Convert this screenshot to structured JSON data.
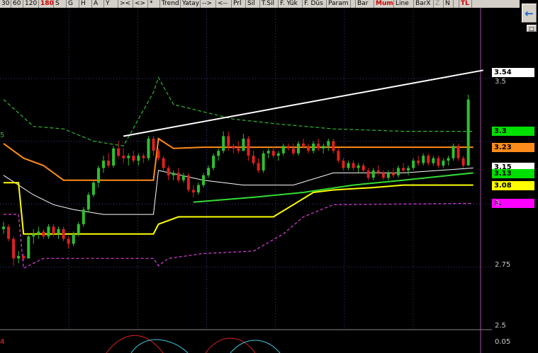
{
  "toolbar": [
    {
      "label": "30",
      "w": 16
    },
    {
      "label": "60",
      "w": 17
    },
    {
      "label": "120",
      "w": 22
    },
    {
      "label": "180",
      "w": 21,
      "style": "red"
    },
    {
      "label": "S",
      "w": 18
    },
    {
      "label": "G",
      "w": 18
    },
    {
      "label": "H",
      "w": 18
    },
    {
      "label": "A",
      "w": 17
    },
    {
      "label": "Y",
      "w": 20
    },
    {
      "label": "><",
      "w": 21
    },
    {
      "label": "<>",
      "w": 21
    },
    {
      "label": "*",
      "w": 17
    },
    {
      "label": "Trend",
      "w": 29
    },
    {
      "label": "Yatay",
      "w": 28
    },
    {
      "label": "-->",
      "w": 22
    },
    {
      "label": "<--",
      "w": 22
    },
    {
      "label": "Prl",
      "w": 20
    },
    {
      "label": "Sil",
      "w": 20
    },
    {
      "label": "T.Sil",
      "w": 26
    },
    {
      "label": "F. Yük",
      "w": 34
    },
    {
      "label": "F. Düs",
      "w": 34
    },
    {
      "label": "Param",
      "w": 34
    },
    {
      "label": "",
      "w": 7
    },
    {
      "label": "Bar",
      "w": 26
    },
    {
      "label": "Mum",
      "w": 28,
      "style": "red"
    },
    {
      "label": "Line",
      "w": 28
    },
    {
      "label": "BarX",
      "w": 28
    },
    {
      "label": "Z",
      "w": 14,
      "style": "disabled"
    },
    {
      "label": "N",
      "w": 14
    },
    {
      "label": "",
      "w": 8
    },
    {
      "label": "TL",
      "w": 18,
      "style": "red"
    }
  ],
  "nav": {
    "back_icon": "←",
    "close_icon": "□"
  },
  "price_tags": [
    {
      "label": "3.54",
      "bg": "#ffffff",
      "fg": "#000000",
      "price": 3.54
    },
    {
      "label": "3.3",
      "bg": "#00e000",
      "fg": "#000000",
      "price": 3.3
    },
    {
      "label": "3.23",
      "bg": "#ff8c1a",
      "fg": "#000000",
      "price": 3.235
    },
    {
      "label": "3.15",
      "bg": "#ffffff",
      "fg": "#000000",
      "price": 3.153
    },
    {
      "label": "3.13",
      "bg": "#00e000",
      "fg": "#000000",
      "price": 3.128
    },
    {
      "label": "3.08",
      "bg": "#ffff00",
      "fg": "#000000",
      "price": 3.077
    },
    {
      "label": "3.",
      "bg": "#ff00ff",
      "fg": "#000000",
      "price": 3.005
    }
  ],
  "axis_ticks": [
    {
      "label": "3.5",
      "price": 3.5
    },
    {
      "label": "3",
      "price": 3.0
    },
    {
      "label": "2.75",
      "price": 2.75
    },
    {
      "label": "2.5",
      "price": 2.5
    }
  ],
  "osc_tick": "0.05",
  "left_labels": [
    {
      "label": "5",
      "color": "#3cb43c"
    },
    {
      "label": "4",
      "color": "#ff3030"
    }
  ],
  "chart_data": {
    "type": "candlestick",
    "y_axis": {
      "min": 2.5,
      "max": 3.6
    },
    "colors": {
      "up": "#30c030",
      "down": "#e02020",
      "upper_band": "#2db82d",
      "orange": "#ff8c1a",
      "white_line": "#ffffff",
      "yellow": "#ffff00",
      "green_ma": "#33dd33",
      "magenta": "#e040e0",
      "trend": "#ffffff"
    },
    "candles": [
      [
        2.9,
        2.93,
        2.88,
        2.91
      ],
      [
        2.91,
        2.92,
        2.85,
        2.86
      ],
      [
        2.86,
        2.87,
        2.75,
        2.78
      ],
      [
        2.78,
        2.81,
        2.76,
        2.79
      ],
      [
        2.79,
        2.8,
        2.77,
        2.78
      ],
      [
        2.78,
        2.88,
        2.78,
        2.87
      ],
      [
        2.87,
        2.9,
        2.84,
        2.88
      ],
      [
        2.88,
        2.91,
        2.86,
        2.89
      ],
      [
        2.89,
        2.9,
        2.86,
        2.87
      ],
      [
        2.87,
        2.92,
        2.86,
        2.91
      ],
      [
        2.91,
        2.92,
        2.87,
        2.88
      ],
      [
        2.88,
        2.91,
        2.86,
        2.9
      ],
      [
        2.9,
        2.91,
        2.85,
        2.86
      ],
      [
        2.86,
        2.87,
        2.82,
        2.84
      ],
      [
        2.84,
        2.89,
        2.83,
        2.88
      ],
      [
        2.88,
        2.93,
        2.87,
        2.92
      ],
      [
        2.92,
        2.99,
        2.91,
        2.98
      ],
      [
        2.98,
        3.05,
        2.97,
        3.04
      ],
      [
        3.04,
        3.1,
        3.03,
        3.09
      ],
      [
        3.09,
        3.16,
        3.07,
        3.15
      ],
      [
        3.15,
        3.2,
        3.13,
        3.18
      ],
      [
        3.18,
        3.21,
        3.15,
        3.16
      ],
      [
        3.16,
        3.24,
        3.15,
        3.23
      ],
      [
        3.23,
        3.26,
        3.19,
        3.2
      ],
      [
        3.2,
        3.23,
        3.17,
        3.19
      ],
      [
        3.19,
        3.21,
        3.16,
        3.2
      ],
      [
        3.2,
        3.22,
        3.17,
        3.18
      ],
      [
        3.18,
        3.21,
        3.16,
        3.2
      ],
      [
        3.2,
        3.21,
        3.17,
        3.19
      ],
      [
        3.19,
        3.28,
        3.18,
        3.27
      ],
      [
        3.27,
        3.28,
        3.2,
        3.22
      ],
      [
        3.22,
        3.23,
        3.18,
        3.19
      ],
      [
        3.19,
        3.2,
        3.14,
        3.15
      ],
      [
        3.15,
        3.16,
        3.1,
        3.12
      ],
      [
        3.12,
        3.14,
        3.1,
        3.13
      ],
      [
        3.13,
        3.15,
        3.09,
        3.1
      ],
      [
        3.1,
        3.13,
        3.09,
        3.12
      ],
      [
        3.12,
        3.13,
        3.05,
        3.06
      ],
      [
        3.06,
        3.08,
        3.03,
        3.05
      ],
      [
        3.05,
        3.09,
        3.04,
        3.08
      ],
      [
        3.08,
        3.13,
        3.07,
        3.12
      ],
      [
        3.12,
        3.16,
        3.11,
        3.15
      ],
      [
        3.15,
        3.21,
        3.14,
        3.2
      ],
      [
        3.2,
        3.23,
        3.18,
        3.22
      ],
      [
        3.22,
        3.3,
        3.21,
        3.28
      ],
      [
        3.28,
        3.3,
        3.22,
        3.24
      ],
      [
        3.24,
        3.25,
        3.21,
        3.23
      ],
      [
        3.23,
        3.26,
        3.21,
        3.22
      ],
      [
        3.22,
        3.29,
        3.22,
        3.27
      ],
      [
        3.27,
        3.28,
        3.18,
        3.2
      ],
      [
        3.2,
        3.22,
        3.16,
        3.17
      ],
      [
        3.17,
        3.19,
        3.13,
        3.14
      ],
      [
        3.14,
        3.22,
        3.13,
        3.21
      ],
      [
        3.21,
        3.23,
        3.19,
        3.22
      ],
      [
        3.22,
        3.24,
        3.19,
        3.2
      ],
      [
        3.2,
        3.22,
        3.18,
        3.21
      ],
      [
        3.21,
        3.25,
        3.2,
        3.24
      ],
      [
        3.24,
        3.25,
        3.22,
        3.23
      ],
      [
        3.23,
        3.25,
        3.2,
        3.21
      ],
      [
        3.21,
        3.26,
        3.2,
        3.25
      ],
      [
        3.25,
        3.27,
        3.23,
        3.24
      ],
      [
        3.24,
        3.25,
        3.21,
        3.22
      ],
      [
        3.22,
        3.26,
        3.21,
        3.25
      ],
      [
        3.25,
        3.27,
        3.22,
        3.23
      ],
      [
        3.23,
        3.25,
        3.21,
        3.24
      ],
      [
        3.24,
        3.27,
        3.22,
        3.26
      ],
      [
        3.26,
        3.27,
        3.21,
        3.22
      ],
      [
        3.22,
        3.23,
        3.17,
        3.18
      ],
      [
        3.18,
        3.19,
        3.14,
        3.15
      ],
      [
        3.15,
        3.18,
        3.14,
        3.17
      ],
      [
        3.17,
        3.18,
        3.14,
        3.15
      ],
      [
        3.15,
        3.17,
        3.13,
        3.16
      ],
      [
        3.16,
        3.17,
        3.13,
        3.14
      ],
      [
        3.14,
        3.15,
        3.1,
        3.11
      ],
      [
        3.11,
        3.15,
        3.1,
        3.14
      ],
      [
        3.14,
        3.16,
        3.12,
        3.13
      ],
      [
        3.13,
        3.14,
        3.1,
        3.11
      ],
      [
        3.11,
        3.14,
        3.1,
        3.13
      ],
      [
        3.13,
        3.15,
        3.11,
        3.12
      ],
      [
        3.12,
        3.16,
        3.11,
        3.15
      ],
      [
        3.15,
        3.17,
        3.13,
        3.14
      ],
      [
        3.14,
        3.16,
        3.12,
        3.15
      ],
      [
        3.15,
        3.19,
        3.14,
        3.18
      ],
      [
        3.18,
        3.2,
        3.16,
        3.17
      ],
      [
        3.17,
        3.21,
        3.16,
        3.2
      ],
      [
        3.2,
        3.21,
        3.16,
        3.17
      ],
      [
        3.17,
        3.2,
        3.16,
        3.19
      ],
      [
        3.19,
        3.2,
        3.15,
        3.16
      ],
      [
        3.16,
        3.19,
        3.15,
        3.18
      ],
      [
        3.18,
        3.2,
        3.16,
        3.19
      ],
      [
        3.19,
        3.25,
        3.18,
        3.24
      ],
      [
        3.24,
        3.25,
        3.18,
        3.19
      ],
      [
        3.19,
        3.2,
        3.15,
        3.16
      ],
      [
        3.16,
        3.45,
        3.16,
        3.43
      ]
    ],
    "upper_band": [
      [
        0,
        3.43
      ],
      [
        6,
        3.32
      ],
      [
        12,
        3.31
      ],
      [
        18,
        3.26
      ],
      [
        24,
        3.24
      ],
      [
        30,
        3.46
      ],
      [
        31,
        3.52
      ],
      [
        34,
        3.41
      ],
      [
        40,
        3.38
      ],
      [
        46,
        3.35
      ],
      [
        55,
        3.33
      ],
      [
        66,
        3.31
      ],
      [
        80,
        3.3
      ],
      [
        94,
        3.3
      ]
    ],
    "orange": [
      [
        0,
        3.25
      ],
      [
        4,
        3.19
      ],
      [
        8,
        3.16
      ],
      [
        12,
        3.1
      ],
      [
        18,
        3.1
      ],
      [
        22,
        3.1
      ],
      [
        30,
        3.1
      ],
      [
        31,
        3.27
      ],
      [
        34,
        3.23
      ],
      [
        40,
        3.235
      ],
      [
        60,
        3.235
      ],
      [
        94,
        3.235
      ]
    ],
    "white_line": [
      [
        0,
        3.12
      ],
      [
        6,
        3.04
      ],
      [
        10,
        3.0
      ],
      [
        14,
        2.98
      ],
      [
        20,
        2.96
      ],
      [
        30,
        2.96
      ],
      [
        31,
        3.14
      ],
      [
        40,
        3.1
      ],
      [
        48,
        3.08
      ],
      [
        58,
        3.08
      ],
      [
        66,
        3.13
      ],
      [
        74,
        3.13
      ],
      [
        80,
        3.13
      ],
      [
        94,
        3.15
      ]
    ],
    "yellow": [
      [
        0,
        3.09
      ],
      [
        3,
        3.09
      ],
      [
        4,
        2.88
      ],
      [
        18,
        2.88
      ],
      [
        30,
        2.88
      ],
      [
        31,
        2.92
      ],
      [
        35,
        2.95
      ],
      [
        46,
        2.95
      ],
      [
        54,
        2.95
      ],
      [
        58,
        3.0
      ],
      [
        62,
        3.05
      ],
      [
        66,
        3.06
      ],
      [
        74,
        3.07
      ],
      [
        80,
        3.08
      ],
      [
        94,
        3.08
      ]
    ],
    "green_ma": [
      [
        38,
        3.01
      ],
      [
        50,
        3.03
      ],
      [
        60,
        3.05
      ],
      [
        70,
        3.08
      ],
      [
        80,
        3.1
      ],
      [
        94,
        3.13
      ]
    ],
    "magenta": [
      [
        0,
        2.96
      ],
      [
        3,
        2.96
      ],
      [
        4,
        2.74
      ],
      [
        8,
        2.78
      ],
      [
        18,
        2.78
      ],
      [
        30,
        2.78
      ],
      [
        31,
        2.75
      ],
      [
        33,
        2.78
      ],
      [
        40,
        2.8
      ],
      [
        50,
        2.81
      ],
      [
        56,
        2.88
      ],
      [
        60,
        2.95
      ],
      [
        66,
        3.0
      ],
      [
        94,
        3.005
      ]
    ],
    "trend": [
      [
        24,
        3.28
      ],
      [
        96,
        3.55
      ]
    ]
  }
}
